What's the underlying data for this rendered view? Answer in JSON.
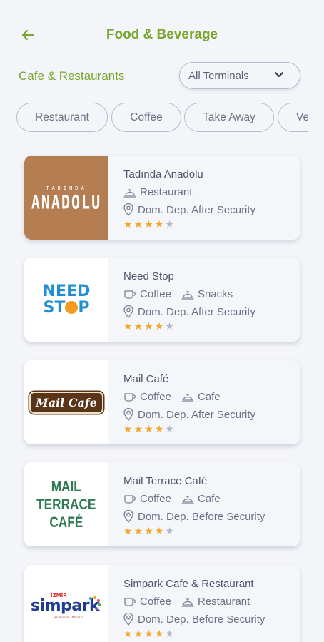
{
  "header": {
    "title": "Food & Beverage",
    "back_icon": "arrow-left-icon"
  },
  "section": {
    "title": "Cafe & Restaurants"
  },
  "terminal_filter": {
    "selected": "All Terminals",
    "icon": "chevron-down-icon"
  },
  "chips": [
    "Restaurant",
    "Coffee",
    "Take Away",
    "Ve"
  ],
  "colors": {
    "accent": "#79a62e",
    "star_on": "#f0a82a",
    "star_off": "#b3b7c3"
  },
  "logo_text": {
    "anadolu": [
      "TADINDA",
      "ANADOLU"
    ],
    "needstop": [
      "NEED",
      "ST",
      "P"
    ],
    "mailcafe": "Mail Cafe",
    "terrace": [
      "MAIL",
      "TERRACE",
      "CAFÉ"
    ],
    "simpark": [
      "İZMİR",
      "simpark",
      "Havalimanı Otoparkı"
    ]
  },
  "venues": [
    {
      "name": "Tadında Anadolu",
      "tags": [
        "Restaurant"
      ],
      "location": "Dom. Dep. After Security",
      "rating": 4,
      "max_rating": 5
    },
    {
      "name": "Need Stop",
      "tags": [
        "Coffee",
        "Snacks"
      ],
      "location": "Dom. Dep. After Security",
      "rating": 4,
      "max_rating": 5
    },
    {
      "name": "Mail Café",
      "tags": [
        "Coffee",
        "Cafe"
      ],
      "location": "Dom. Dep. After Security",
      "rating": 4,
      "max_rating": 5
    },
    {
      "name": "Mail Terrace Café",
      "tags": [
        "Coffee",
        "Cafe"
      ],
      "location": "Dom. Dep. Before Security",
      "rating": 4,
      "max_rating": 5
    },
    {
      "name": "Simpark Cafe & Restaurant",
      "tags": [
        "Coffee",
        "Restaurant"
      ],
      "location": "Dom. Dep. Before Security",
      "rating": 4,
      "max_rating": 5
    }
  ]
}
